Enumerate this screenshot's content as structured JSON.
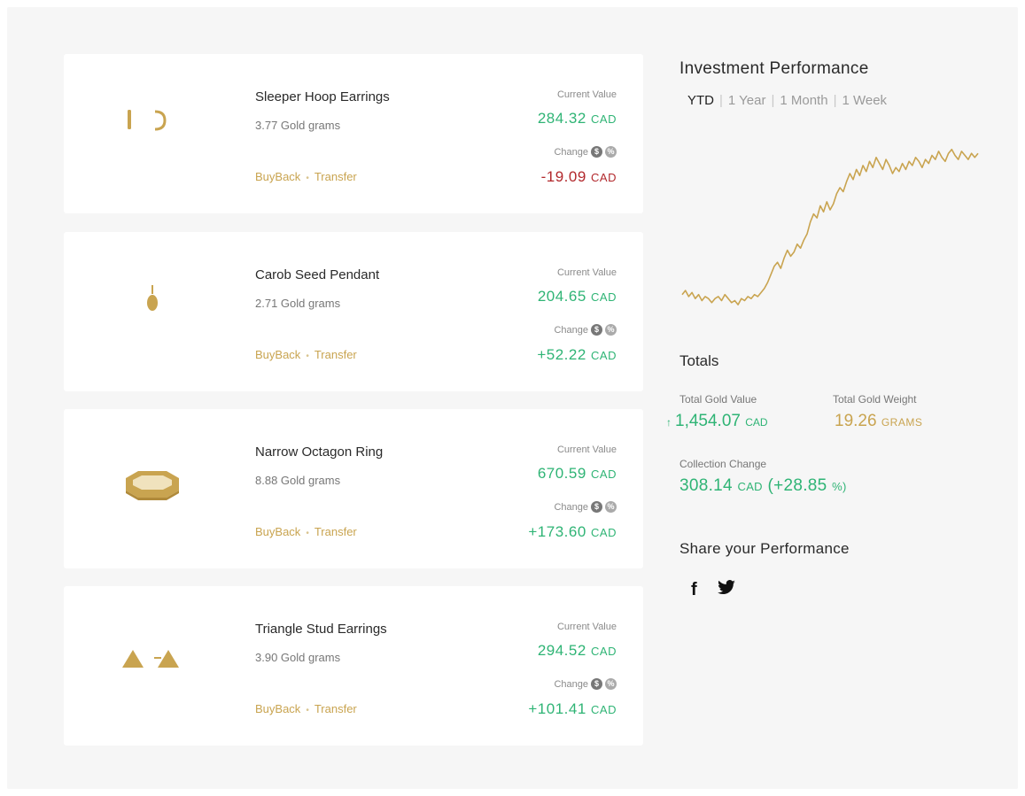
{
  "items": [
    {
      "name": "Sleeper Hoop Earrings",
      "weight": "3.77 Gold grams",
      "buyback": "BuyBack",
      "sep": "•",
      "transfer": "Transfer",
      "current_label": "Current Value",
      "current_value": "284.32",
      "current_unit": "CAD",
      "change_label": "Change",
      "change_value": "-19.09",
      "change_unit": "CAD",
      "icon": "hoop-earrings-icon"
    },
    {
      "name": "Carob Seed Pendant",
      "weight": "2.71 Gold grams",
      "buyback": "BuyBack",
      "sep": "•",
      "transfer": "Transfer",
      "current_label": "Current Value",
      "current_value": "204.65",
      "current_unit": "CAD",
      "change_label": "Change",
      "change_value": "+52.22",
      "change_unit": "CAD",
      "icon": "pendant-icon"
    },
    {
      "name": "Narrow Octagon Ring",
      "weight": "8.88 Gold grams",
      "buyback": "BuyBack",
      "sep": "•",
      "transfer": "Transfer",
      "current_label": "Current Value",
      "current_value": "670.59",
      "current_unit": "CAD",
      "change_label": "Change",
      "change_value": "+173.60",
      "change_unit": "CAD",
      "icon": "octagon-ring-icon"
    },
    {
      "name": "Triangle Stud Earrings",
      "weight": "3.90 Gold grams",
      "buyback": "BuyBack",
      "sep": "•",
      "transfer": "Transfer",
      "current_label": "Current Value",
      "current_value": "294.52",
      "current_unit": "CAD",
      "change_label": "Change",
      "change_value": "+101.41",
      "change_unit": "CAD",
      "icon": "triangle-earrings-icon"
    }
  ],
  "performance": {
    "title": "Investment Performance",
    "periods": [
      "YTD",
      "1 Year",
      "1 Month",
      "1 Week"
    ],
    "active_period": "YTD",
    "separator": "|",
    "line_color": "#c9a450"
  },
  "chart_data": {
    "type": "line",
    "x": [
      0,
      1,
      2,
      3,
      4,
      5,
      6,
      7,
      8,
      9,
      10,
      11,
      12,
      13,
      14,
      15,
      16,
      17,
      18,
      19,
      20,
      21,
      22,
      23,
      24,
      25,
      26,
      27,
      28,
      29,
      30,
      31,
      32,
      33,
      34,
      35,
      36,
      37,
      38,
      39,
      40,
      41,
      42,
      43,
      44,
      45,
      46,
      47,
      48,
      49,
      50,
      51,
      52,
      53,
      54,
      55,
      56,
      57,
      58,
      59,
      60,
      61,
      62,
      63,
      64,
      65,
      66,
      67,
      68,
      69,
      70,
      71,
      72,
      73,
      74,
      75,
      76,
      77,
      78,
      79,
      80,
      81,
      82,
      83,
      84,
      85,
      86,
      87,
      88,
      89,
      90
    ],
    "values": [
      12,
      14,
      11,
      13,
      10,
      12,
      9,
      11,
      10,
      8,
      10,
      11,
      9,
      12,
      10,
      8,
      9,
      7,
      10,
      9,
      11,
      10,
      12,
      11,
      13,
      15,
      18,
      22,
      26,
      28,
      25,
      30,
      34,
      31,
      33,
      37,
      35,
      39,
      42,
      48,
      52,
      50,
      56,
      53,
      58,
      54,
      57,
      62,
      65,
      63,
      68,
      72,
      69,
      74,
      71,
      76,
      73,
      78,
      75,
      80,
      77,
      74,
      79,
      76,
      72,
      75,
      73,
      77,
      74,
      78,
      76,
      80,
      78,
      75,
      79,
      77,
      81,
      79,
      83,
      80,
      78,
      82,
      84,
      81,
      79,
      83,
      81,
      79,
      82,
      80,
      82
    ],
    "title": "",
    "xlabel": "",
    "ylabel": "",
    "ylim": [
      0,
      90
    ],
    "grid": false
  },
  "totals": {
    "title": "Totals",
    "gold_value_label": "Total Gold Value",
    "gold_value_arrow": "↑",
    "gold_value": "1,454.07",
    "gold_value_unit": "CAD",
    "gold_weight_label": "Total Gold Weight",
    "gold_weight": "19.26",
    "gold_weight_unit": "GRAMS",
    "change_label": "Collection Change",
    "change_value": "308.14",
    "change_unit": "CAD",
    "change_pct": "(+28.85",
    "change_pct_unit": "%)"
  },
  "share": {
    "title": "Share your Performance",
    "facebook_glyph": "f",
    "twitter_icon": "twitter-icon"
  },
  "colors": {
    "gold": "#c9a450",
    "positive": "#2fb475",
    "negative": "#b2282c"
  }
}
